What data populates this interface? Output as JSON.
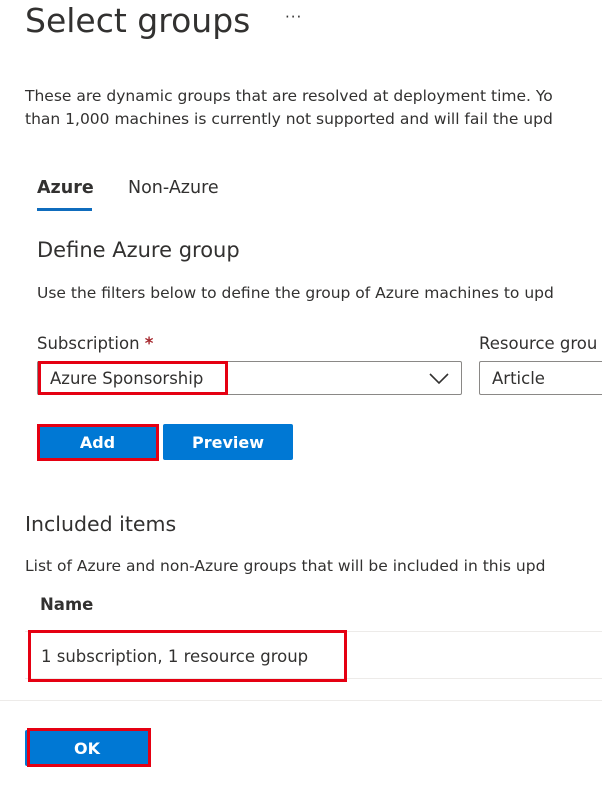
{
  "header": {
    "title": "Select groups",
    "more_label": "···"
  },
  "description": {
    "line1": "These are dynamic groups that are resolved at deployment time. Yo",
    "line2": "than 1,000 machines is currently not supported and will fail the upd"
  },
  "tabs": [
    {
      "label": "Azure",
      "selected": true
    },
    {
      "label": "Non-Azure",
      "selected": false
    }
  ],
  "define": {
    "title": "Define Azure group",
    "help": "Use the filters below to define the group of Azure machines to upd"
  },
  "filters": {
    "subscription_label": "Subscription",
    "required_mark": "*",
    "subscription_value": "Azure Sponsorship",
    "resource_group_label": "Resource grou",
    "resource_group_value": "Article"
  },
  "buttons": {
    "add": "Add",
    "preview": "Preview",
    "ok": "OK"
  },
  "included": {
    "title": "Included items",
    "description": "List of Azure and non-Azure groups that will be included in this upd",
    "column_name": "Name",
    "rows": [
      "1 subscription, 1 resource group"
    ]
  },
  "colors": {
    "accent": "#0078d4",
    "highlight": "#e50012",
    "required": "#a4262c"
  }
}
